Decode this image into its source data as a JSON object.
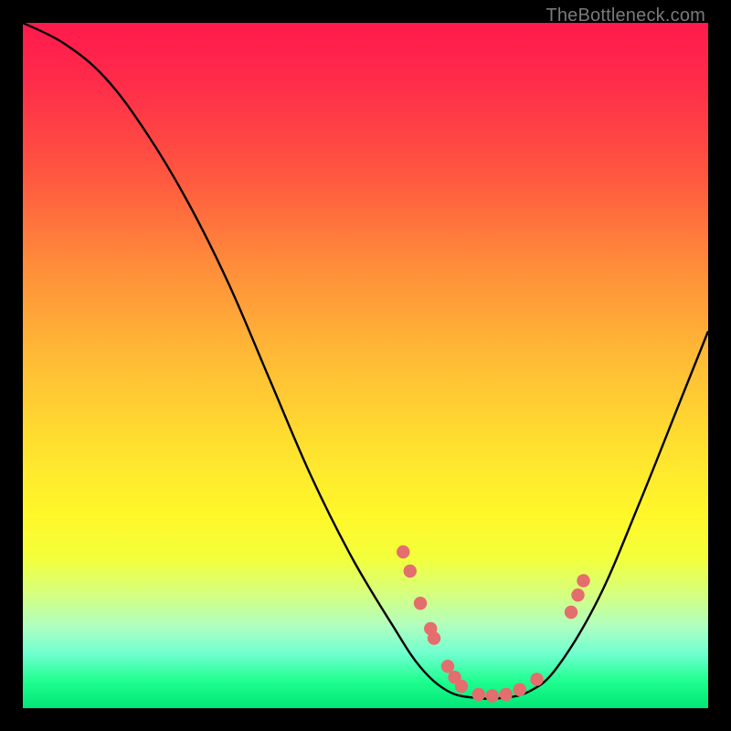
{
  "credit": "TheBottleneck.com",
  "colors": {
    "dot": "#e46d6d",
    "curve": "#000000"
  },
  "chart_data": {
    "type": "line",
    "title": "",
    "xlabel": "",
    "ylabel": "",
    "xlim": [
      0,
      100
    ],
    "ylim": [
      0,
      100
    ],
    "grid": false,
    "legend": false,
    "curve_points": [
      {
        "x": 0,
        "y": 100
      },
      {
        "x": 6,
        "y": 97
      },
      {
        "x": 12,
        "y": 92
      },
      {
        "x": 18,
        "y": 84
      },
      {
        "x": 24,
        "y": 74
      },
      {
        "x": 30,
        "y": 62
      },
      {
        "x": 36,
        "y": 48
      },
      {
        "x": 42,
        "y": 34
      },
      {
        "x": 48,
        "y": 22
      },
      {
        "x": 54,
        "y": 12
      },
      {
        "x": 58,
        "y": 6
      },
      {
        "x": 62,
        "y": 2.5
      },
      {
        "x": 66,
        "y": 1.5
      },
      {
        "x": 70,
        "y": 1.5
      },
      {
        "x": 74,
        "y": 2.5
      },
      {
        "x": 78,
        "y": 6
      },
      {
        "x": 84,
        "y": 16
      },
      {
        "x": 90,
        "y": 30
      },
      {
        "x": 96,
        "y": 45
      },
      {
        "x": 100,
        "y": 55
      }
    ],
    "dots": [
      {
        "x": 55.5,
        "y": 22.8
      },
      {
        "x": 56.5,
        "y": 20.0
      },
      {
        "x": 58.0,
        "y": 15.3
      },
      {
        "x": 59.5,
        "y": 11.6
      },
      {
        "x": 60.0,
        "y": 10.2
      },
      {
        "x": 62.0,
        "y": 6.1
      },
      {
        "x": 63.0,
        "y": 4.5
      },
      {
        "x": 64.0,
        "y": 3.2
      },
      {
        "x": 66.5,
        "y": 2.0
      },
      {
        "x": 68.5,
        "y": 1.8
      },
      {
        "x": 70.5,
        "y": 2.0
      },
      {
        "x": 72.5,
        "y": 2.7
      },
      {
        "x": 75.0,
        "y": 4.2
      },
      {
        "x": 80.0,
        "y": 14.0
      },
      {
        "x": 81.0,
        "y": 16.5
      },
      {
        "x": 81.8,
        "y": 18.6
      }
    ]
  }
}
